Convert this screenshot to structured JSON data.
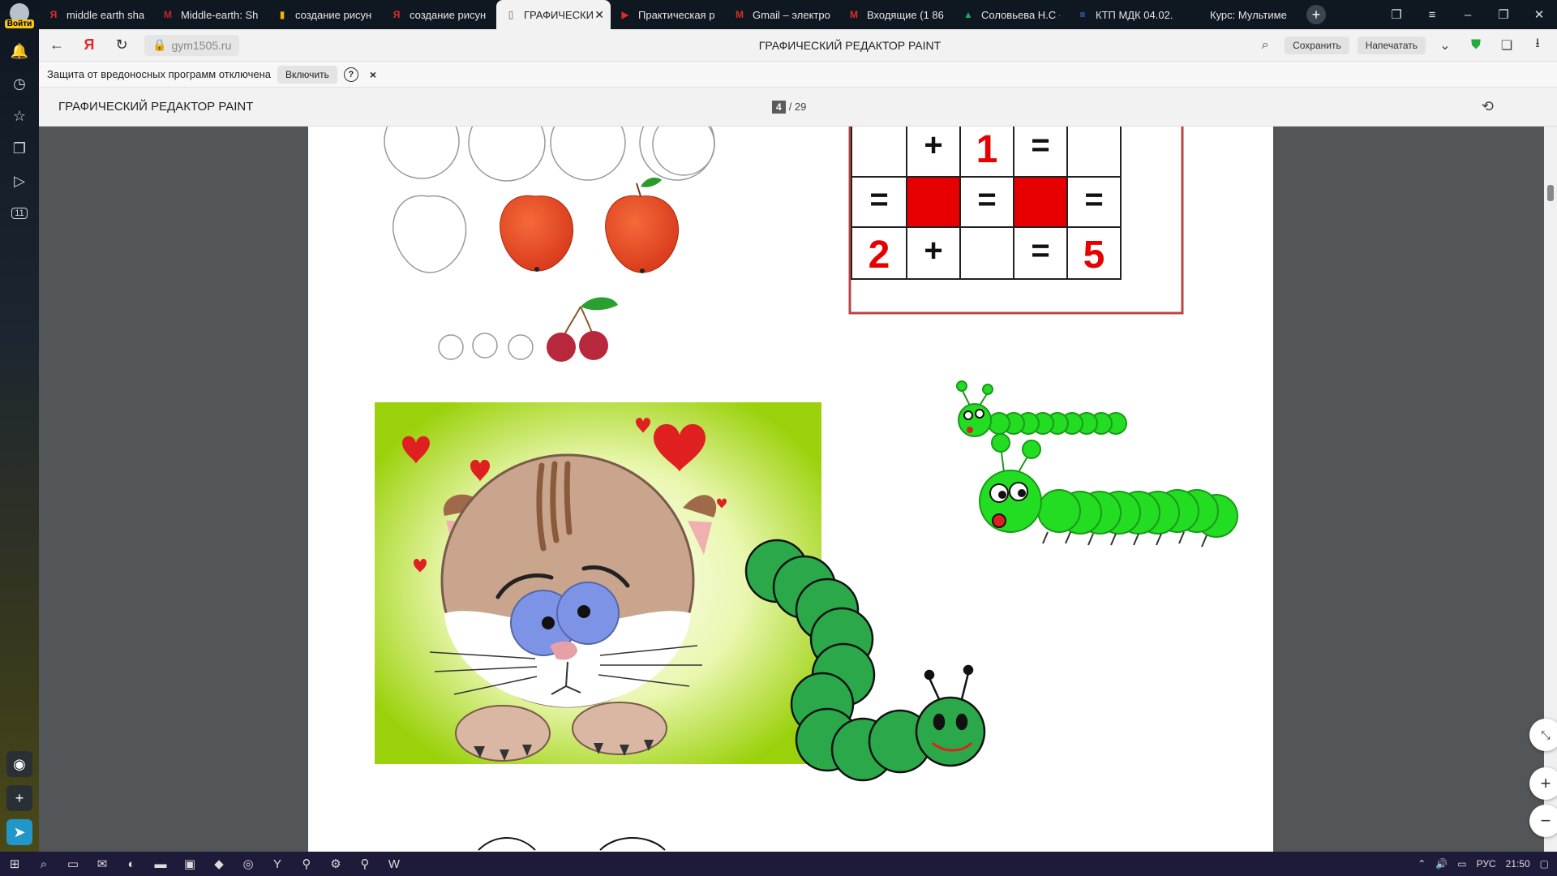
{
  "sidebar": {
    "login_label": "Войти",
    "icons": [
      "bell-icon",
      "history-icon",
      "star-icon",
      "collections-icon",
      "play-icon",
      "counter-icon"
    ],
    "counter": "11"
  },
  "tabs": [
    {
      "title": "middle earth sha",
      "fav": "Я",
      "color": "#e32a2a"
    },
    {
      "title": "Middle-earth: Sh",
      "fav": "M",
      "color": "#c0262f"
    },
    {
      "title": "создание рисун",
      "fav": "▮",
      "color": "#f5b400"
    },
    {
      "title": "создание рисун",
      "fav": "Я",
      "color": "#e32a2a"
    },
    {
      "title": "ГРАФИЧЕСКИ",
      "fav": "▯",
      "color": "#666666",
      "active": true
    },
    {
      "title": "Практическая р",
      "fav": "▶",
      "color": "#e32a2a"
    },
    {
      "title": "Gmail – электро",
      "fav": "M",
      "color": "#d93025"
    },
    {
      "title": "Входящие (1 86",
      "fav": "M",
      "color": "#d93025"
    },
    {
      "title": "Соловьева Н.С -",
      "fav": "▲",
      "color": "#1fa463"
    },
    {
      "title": "КТП МДК 04.02.",
      "fav": "≡",
      "color": "#4285f4"
    },
    {
      "title": "Курс: Мультиме",
      "fav": "",
      "color": "#999999"
    }
  ],
  "address": {
    "url": "gym1505.ru",
    "page_title": "ГРАФИЧЕСКИЙ РЕДАКТОР PAINT",
    "save_label": "Сохранить",
    "print_label": "Напечатать"
  },
  "warning": {
    "text": "Защита от вредоносных программ отключена",
    "enable_label": "Включить",
    "help": "?",
    "close": "×"
  },
  "pdf": {
    "title": "ГРАФИЧЕСКИЙ РЕДАКТОР PAINT",
    "current_page": "4",
    "total_pages": "/ 29"
  },
  "math_grid": {
    "rows": [
      [
        "",
        "+",
        "1",
        "=",
        ""
      ],
      [
        "=",
        "",
        "=",
        "",
        "="
      ],
      [
        "2",
        "+",
        "",
        "=",
        "5"
      ]
    ],
    "red_cells": [
      [
        1,
        1
      ],
      [
        1,
        3
      ]
    ],
    "red_digits": [
      "1",
      "2",
      "5"
    ]
  },
  "taskbar": {
    "lang": "РУС",
    "time": "21:50"
  },
  "colors": {
    "accent_red": "#e60000",
    "caterpillar_green": "#22dd22",
    "caterpillar_dark": "#2aa84a",
    "cat_bg": "#9ad10a"
  }
}
